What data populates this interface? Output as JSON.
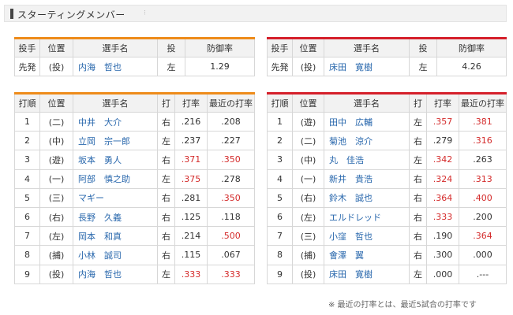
{
  "header": {
    "title": "スターティングメンバー"
  },
  "colors": {
    "team_a_bar": "#ee8b1a",
    "team_b_bar": "#d51f2a",
    "name_link": "#2a68ad",
    "highlight": "#d42b2b"
  },
  "pitcher_headers": [
    "投手",
    "位置",
    "選手名",
    "投",
    "防御率"
  ],
  "batter_headers": [
    "打順",
    "位置",
    "選手名",
    "打",
    "打率",
    "最近の打率"
  ],
  "team_a": {
    "pitcher": {
      "role": "先発",
      "pos": "(投)",
      "name": "内海　哲也",
      "hand": "左",
      "era": "1.29"
    },
    "lineup": [
      {
        "order": "1",
        "pos": "(二)",
        "name": "中井　大介",
        "bat": "右",
        "avg": ".216",
        "recent": ".208",
        "avg_red": false,
        "recent_red": false
      },
      {
        "order": "2",
        "pos": "(中)",
        "name": "立岡　宗一郎",
        "bat": "左",
        "avg": ".237",
        "recent": ".227",
        "avg_red": false,
        "recent_red": false
      },
      {
        "order": "3",
        "pos": "(遊)",
        "name": "坂本　勇人",
        "bat": "右",
        "avg": ".371",
        "recent": ".350",
        "avg_red": true,
        "recent_red": true
      },
      {
        "order": "4",
        "pos": "(一)",
        "name": "阿部　慎之助",
        "bat": "左",
        "avg": ".375",
        "recent": ".278",
        "avg_red": true,
        "recent_red": false
      },
      {
        "order": "5",
        "pos": "(三)",
        "name": "マギー",
        "bat": "右",
        "avg": ".281",
        "recent": ".350",
        "avg_red": false,
        "recent_red": true
      },
      {
        "order": "6",
        "pos": "(右)",
        "name": "長野　久義",
        "bat": "右",
        "avg": ".125",
        "recent": ".118",
        "avg_red": false,
        "recent_red": false
      },
      {
        "order": "7",
        "pos": "(左)",
        "name": "岡本　和真",
        "bat": "右",
        "avg": ".214",
        "recent": ".500",
        "avg_red": false,
        "recent_red": true
      },
      {
        "order": "8",
        "pos": "(捕)",
        "name": "小林　誠司",
        "bat": "右",
        "avg": ".115",
        "recent": ".067",
        "avg_red": false,
        "recent_red": false
      },
      {
        "order": "9",
        "pos": "(投)",
        "name": "内海　哲也",
        "bat": "左",
        "avg": ".333",
        "recent": ".333",
        "avg_red": true,
        "recent_red": true
      }
    ]
  },
  "team_b": {
    "pitcher": {
      "role": "先発",
      "pos": "(投)",
      "name": "床田　寛樹",
      "hand": "左",
      "era": "4.26"
    },
    "lineup": [
      {
        "order": "1",
        "pos": "(遊)",
        "name": "田中　広輔",
        "bat": "左",
        "avg": ".357",
        "recent": ".381",
        "avg_red": true,
        "recent_red": true
      },
      {
        "order": "2",
        "pos": "(二)",
        "name": "菊池　涼介",
        "bat": "右",
        "avg": ".279",
        "recent": ".316",
        "avg_red": false,
        "recent_red": true
      },
      {
        "order": "3",
        "pos": "(中)",
        "name": "丸　佳浩",
        "bat": "左",
        "avg": ".342",
        "recent": ".263",
        "avg_red": true,
        "recent_red": false
      },
      {
        "order": "4",
        "pos": "(一)",
        "name": "新井　貴浩",
        "bat": "右",
        "avg": ".324",
        "recent": ".313",
        "avg_red": true,
        "recent_red": true
      },
      {
        "order": "5",
        "pos": "(右)",
        "name": "鈴木　誠也",
        "bat": "右",
        "avg": ".364",
        "recent": ".400",
        "avg_red": true,
        "recent_red": true
      },
      {
        "order": "6",
        "pos": "(左)",
        "name": "エルドレッド",
        "bat": "右",
        "avg": ".333",
        "recent": ".200",
        "avg_red": true,
        "recent_red": false
      },
      {
        "order": "7",
        "pos": "(三)",
        "name": "小窪　哲也",
        "bat": "右",
        "avg": ".190",
        "recent": ".364",
        "avg_red": false,
        "recent_red": true
      },
      {
        "order": "8",
        "pos": "(捕)",
        "name": "會澤　翼",
        "bat": "右",
        "avg": ".300",
        "recent": ".000",
        "avg_red": false,
        "recent_red": false
      },
      {
        "order": "9",
        "pos": "(投)",
        "name": "床田　寛樹",
        "bat": "左",
        "avg": ".000",
        "recent": ".---",
        "avg_red": false,
        "recent_red": false
      }
    ]
  },
  "footnote": "※ 最近の打率とは、最近5試合の打率です"
}
